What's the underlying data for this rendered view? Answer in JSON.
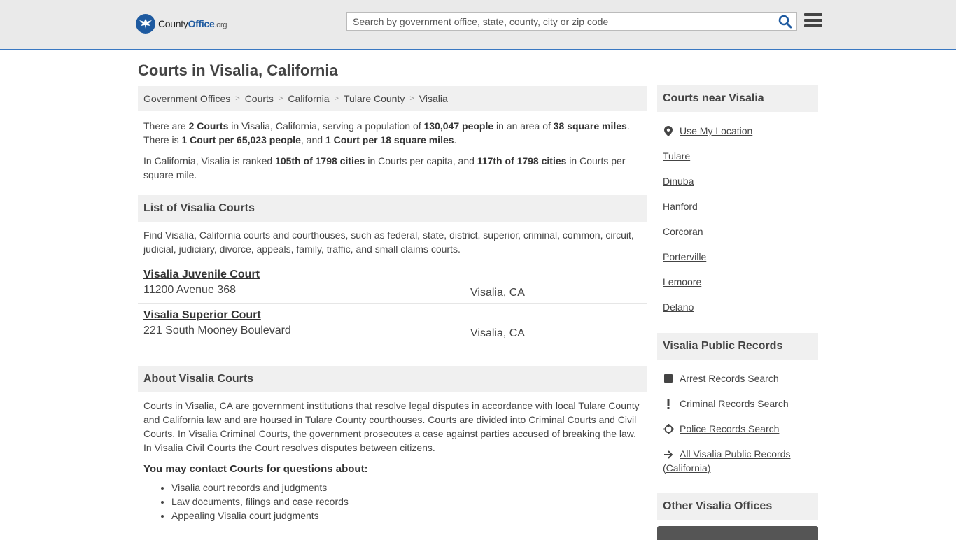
{
  "header": {
    "logo_county": "County",
    "logo_office": "Office",
    "logo_org": ".org",
    "search_placeholder": "Search by government office, state, county, city or zip code"
  },
  "page_title": "Courts in Visalia, California",
  "breadcrumb": [
    "Government Offices",
    "Courts",
    "California",
    "Tulare County",
    "Visalia"
  ],
  "intro": {
    "p1": {
      "a": "There are ",
      "b": "2 Courts",
      "c": " in Visalia, California, serving a population of ",
      "d": "130,047 people",
      "e": " in an area of ",
      "f": "38 square miles",
      "g": ". There is ",
      "h": "1 Court per 65,023 people",
      "i": ", and ",
      "j": "1 Court per 18 square miles",
      "k": "."
    },
    "p2": {
      "a": "In California, Visalia is ranked ",
      "b": "105th of 1798 cities",
      "c": " in Courts per capita, and ",
      "d": "117th of 1798 cities",
      "e": " in Courts per square mile."
    }
  },
  "list_section": {
    "title": "List of Visalia Courts",
    "desc": "Find Visalia, California courts and courthouses, such as federal, state, district, superior, criminal, common, circuit, judicial, judiciary, divorce, appeals, family, traffic, and small claims courts.",
    "courts": [
      {
        "name": "Visalia Juvenile Court",
        "address": "11200 Avenue 368",
        "city": "Visalia, CA"
      },
      {
        "name": "Visalia Superior Court",
        "address": "221 South Mooney Boulevard",
        "city": "Visalia, CA"
      }
    ]
  },
  "about_section": {
    "title": "About Visalia Courts",
    "text": "Courts in Visalia, CA are government institutions that resolve legal disputes in accordance with local Tulare County and California law and are housed in Tulare County courthouses. Courts are divided into Criminal Courts and Civil Courts. In Visalia Criminal Courts, the government prosecutes a case against parties accused of breaking the law. In Visalia Civil Courts the Court resolves disputes between citizens.",
    "contact_heading": "You may contact Courts for questions about:",
    "questions": [
      "Visalia court records and judgments",
      "Law documents, filings and case records",
      "Appealing Visalia court judgments"
    ]
  },
  "sidebar": {
    "near_title": "Courts near Visalia",
    "use_location": "Use My Location",
    "near_cities": [
      "Tulare",
      "Dinuba",
      "Hanford",
      "Corcoran",
      "Porterville",
      "Lemoore",
      "Delano"
    ],
    "records_title": "Visalia Public Records",
    "records": [
      {
        "label": "Arrest Records Search",
        "icon": "square-icon"
      },
      {
        "label": "Criminal Records Search",
        "icon": "exclamation-icon"
      },
      {
        "label": "Police Records Search",
        "icon": "crosshair-icon"
      },
      {
        "label": "All Visalia Public Records (California)",
        "icon": "arrow-right-icon"
      }
    ],
    "other_title": "Other Visalia Offices"
  },
  "colors": {
    "accent": "#3a78c2",
    "logo_blue": "#1e5aa0",
    "panel_bg": "#f0f0f0"
  }
}
